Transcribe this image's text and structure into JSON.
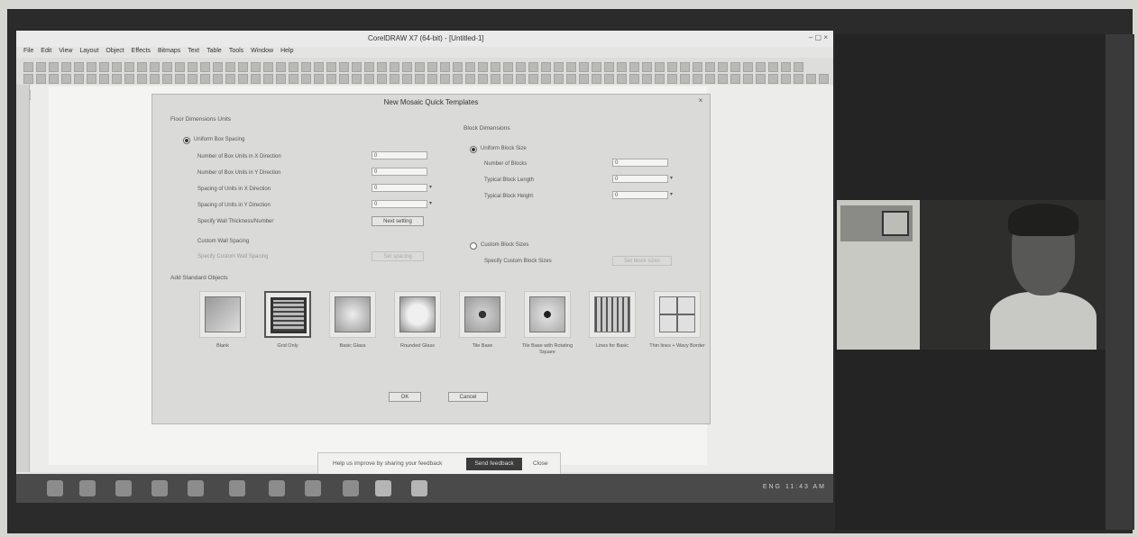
{
  "window": {
    "title": "CorelDRAW X7 (64-bit) - [Untitled-1]",
    "controls": "– ▢ ×"
  },
  "menu": [
    "File",
    "Edit",
    "View",
    "Layout",
    "Object",
    "Effects",
    "Bitmaps",
    "Text",
    "Table",
    "Tools",
    "Window",
    "Help"
  ],
  "dialog": {
    "title": "New Mosaic Quick Templates",
    "close": "×",
    "left_group": "Floor Dimensions Units",
    "left_radio_on": true,
    "left_radio": "Uniform Box Spacing",
    "left_fields": [
      {
        "label": "Number of Box Units in X Direction",
        "value": "0"
      },
      {
        "label": "Number of Box Units in Y Direction",
        "value": "0"
      },
      {
        "label": "Spacing of Units in X Direction",
        "value": "0"
      },
      {
        "label": "Spacing of Units in Y Direction",
        "value": "0"
      },
      {
        "label": "Specify Wall Thickness/Number",
        "value": ""
      }
    ],
    "left_button": "Next setting",
    "custom_left_label": "Custom Wall Spacing",
    "custom_left_sub": "Specify Custom Wall Spacing",
    "custom_left_btn": "Set spacing",
    "right_group": "Block Dimensions",
    "right_radio_on": true,
    "right_radio": "Uniform Block Size",
    "right_fields": [
      {
        "label": "Number of Blocks",
        "value": "0"
      },
      {
        "label": "Typical Block Length",
        "value": "0"
      },
      {
        "label": "Typical Block Height",
        "value": "0"
      }
    ],
    "custom_right_label": "Custom Block Sizes",
    "custom_right_sub": "Specify Custom Block Sizes",
    "custom_right_btn": "Set block sizes",
    "thumbs_group": "Add Standard Objects",
    "thumbnails": [
      {
        "label": "Blank"
      },
      {
        "label": "Grid Only"
      },
      {
        "label": "Basic Glass"
      },
      {
        "label": "Rounded Glass"
      },
      {
        "label": "Tile Base"
      },
      {
        "label": "Tile Base with Rotating Square"
      },
      {
        "label": "Lines for Basic"
      },
      {
        "label": "Thin lines + Wavy Border"
      }
    ],
    "ok": "OK",
    "cancel": "Cancel"
  },
  "notify": {
    "message": "Help us improve by sharing your feedback",
    "button": "Send feedback",
    "close": "Close"
  },
  "taskbar": {
    "tray": "ENG 11:43 AM"
  },
  "webcam": {
    "caption": ""
  }
}
